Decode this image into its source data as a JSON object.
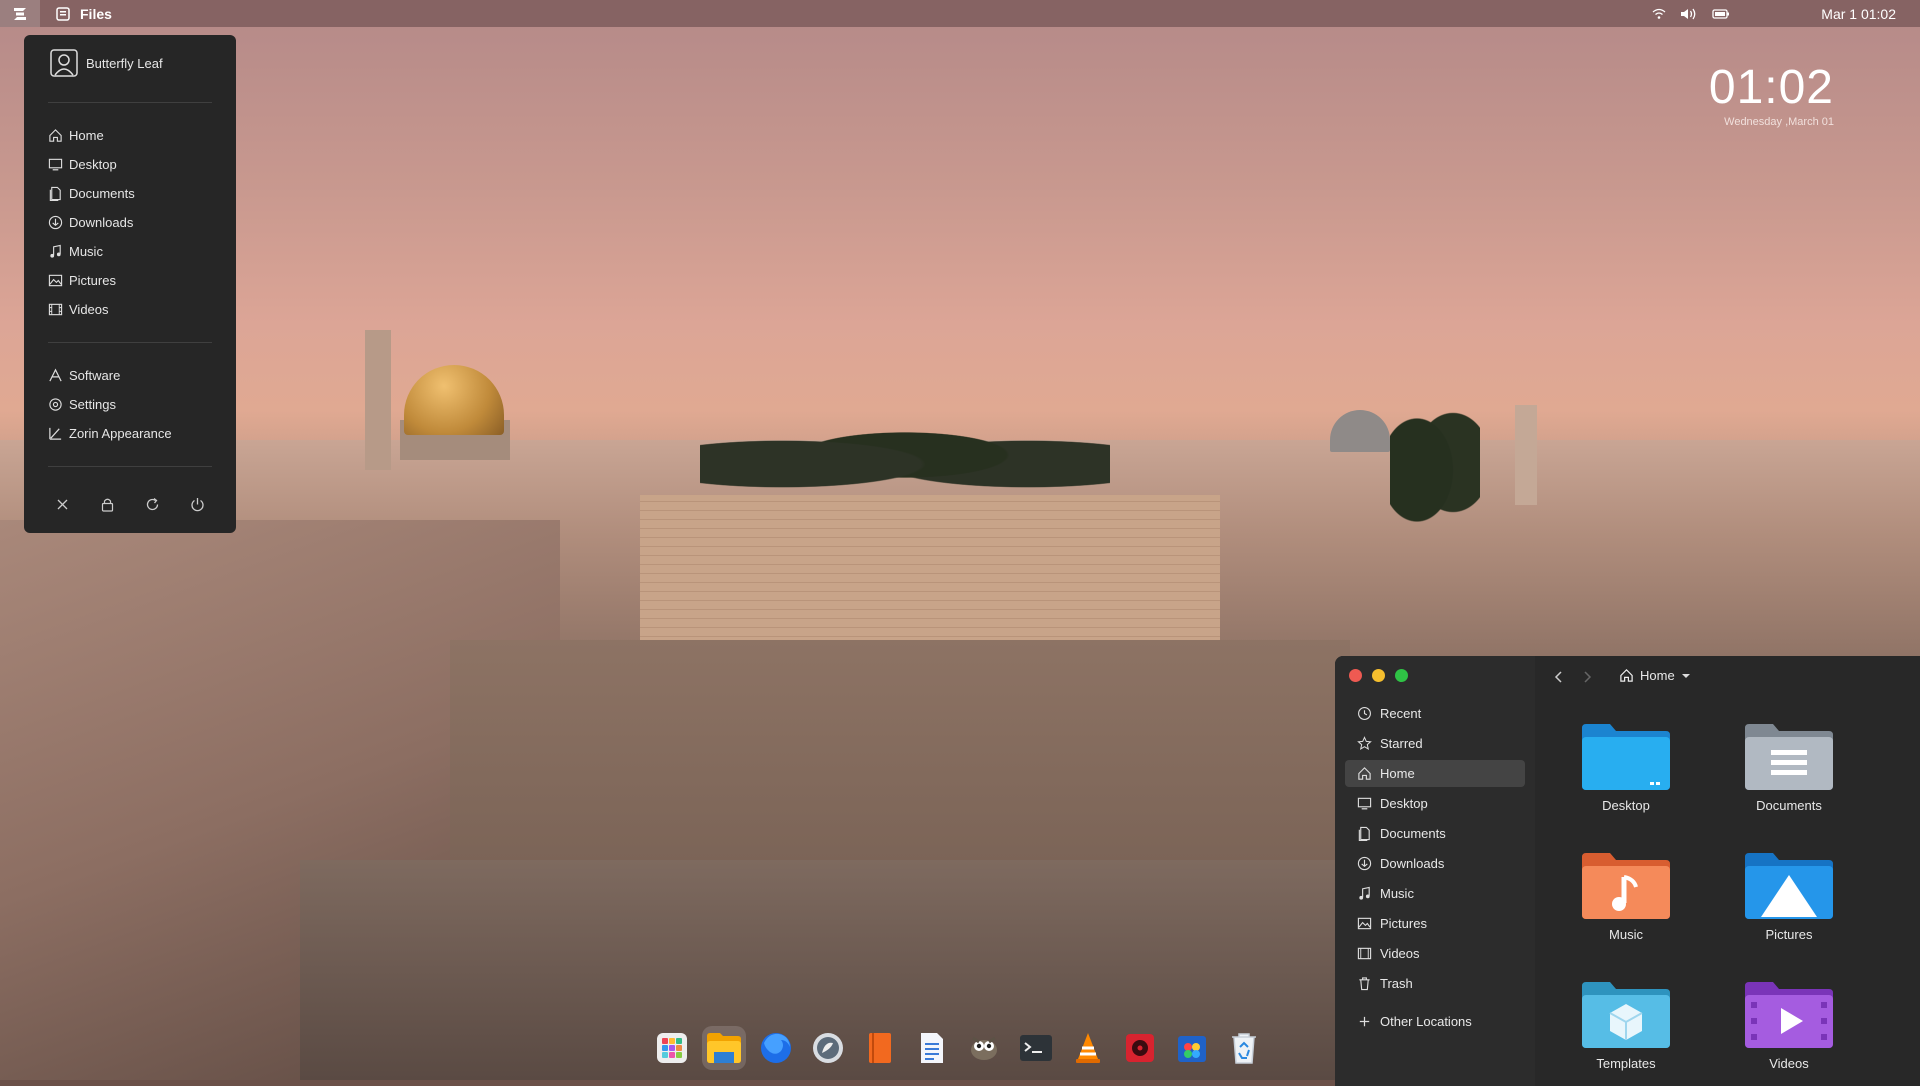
{
  "topbar": {
    "app_name": "Files",
    "datetime": "Mar 1  01:02",
    "icons": [
      "zorin-menu-icon",
      "files-app-icon",
      "wifi-icon",
      "volume-icon",
      "battery-icon"
    ]
  },
  "clock_widget": {
    "time": "01:02",
    "date": "Wednesday ,March 01"
  },
  "start_menu": {
    "user_name": "Butterfly  Leaf",
    "places": [
      {
        "label": "Home",
        "icon": "home-icon"
      },
      {
        "label": "Desktop",
        "icon": "desktop-icon"
      },
      {
        "label": "Documents",
        "icon": "documents-icon"
      },
      {
        "label": "Downloads",
        "icon": "downloads-icon"
      },
      {
        "label": "Music",
        "icon": "music-icon"
      },
      {
        "label": "Pictures",
        "icon": "pictures-icon"
      },
      {
        "label": "Videos",
        "icon": "videos-icon"
      }
    ],
    "system": [
      {
        "label": "Software",
        "icon": "software-icon"
      },
      {
        "label": "Settings",
        "icon": "settings-icon"
      },
      {
        "label": "Zorin Appearance",
        "icon": "appearance-icon"
      }
    ],
    "actions": [
      "close-icon",
      "lock-icon",
      "restart-icon",
      "power-icon"
    ]
  },
  "files_window": {
    "path_label": "Home",
    "sidebar": [
      {
        "label": "Recent",
        "icon": "recent-icon"
      },
      {
        "label": "Starred",
        "icon": "star-icon"
      },
      {
        "label": "Home",
        "icon": "home-icon",
        "active": true
      },
      {
        "label": "Desktop",
        "icon": "desktop-icon"
      },
      {
        "label": "Documents",
        "icon": "documents-icon"
      },
      {
        "label": "Downloads",
        "icon": "downloads-icon"
      },
      {
        "label": "Music",
        "icon": "music-icon"
      },
      {
        "label": "Pictures",
        "icon": "pictures-icon"
      },
      {
        "label": "Videos",
        "icon": "videos-icon"
      },
      {
        "label": "Trash",
        "icon": "trash-icon"
      },
      {
        "label": "Other Locations",
        "icon": "plus-icon"
      }
    ],
    "folders": [
      {
        "label": "Desktop",
        "color": "#1f9ee8"
      },
      {
        "label": "Documents",
        "color": "#9aa3ad"
      },
      {
        "label": "Music",
        "color": "#f07b4c"
      },
      {
        "label": "Pictures",
        "color": "#1f8fe0"
      },
      {
        "label": "Templates",
        "color": "#4ab0d8"
      },
      {
        "label": "Videos",
        "color": "#9c4fd6"
      }
    ],
    "window_controls": {
      "close": "#ee5a52",
      "minimize": "#f5be2e",
      "maximize": "#2fc345"
    }
  },
  "dock": {
    "apps": [
      "app-grid-icon",
      "files-icon",
      "firefox-icon",
      "maps-icon",
      "books-icon",
      "text-editor-icon",
      "gimp-icon",
      "terminal-icon",
      "vlc-icon",
      "media-player-icon",
      "software-store-icon",
      "recycle-icon"
    ]
  }
}
